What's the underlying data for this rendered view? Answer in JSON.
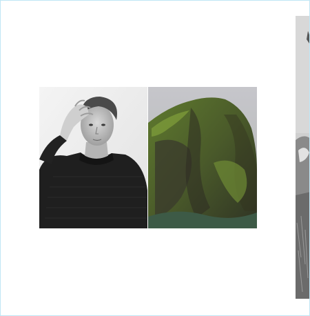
{
  "gallery": {
    "images": [
      {
        "subject": "portrait-man-knit-sweater",
        "tone": "grayscale"
      },
      {
        "subject": "mossy-sea-rock",
        "tone": "color"
      },
      {
        "subject": "partial-portrait-cropped",
        "tone": "grayscale"
      }
    ],
    "colors": {
      "frame_border": "#bfe6f5",
      "background": "#ffffff",
      "moss": "#5e7b2f",
      "rock": "#3b3a2c",
      "sky": "#c9c9cd",
      "sweater": "#1c1c1c"
    }
  }
}
